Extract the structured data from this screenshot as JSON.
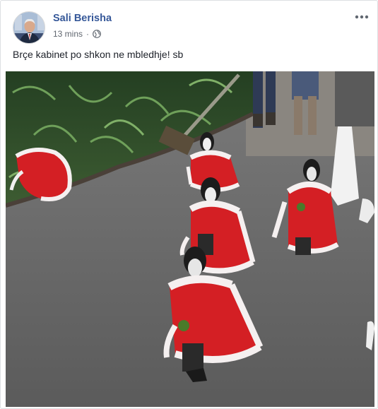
{
  "post": {
    "author_name": "Sali Berisha",
    "timestamp": "13 mins",
    "separator": "·",
    "privacy_icon": "globe-icon",
    "more_icon": "more-options-icon",
    "text": "Brçe kabinet po shkon ne mbledhje! sb",
    "media": {
      "type": "video",
      "content": "penguins-in-christmas-capes-walking"
    }
  },
  "colors": {
    "author_link": "#365899",
    "meta_text": "#616770",
    "body_text": "#1d2129",
    "card_border": "#dddfe2",
    "cape_red": "#d41f24"
  }
}
